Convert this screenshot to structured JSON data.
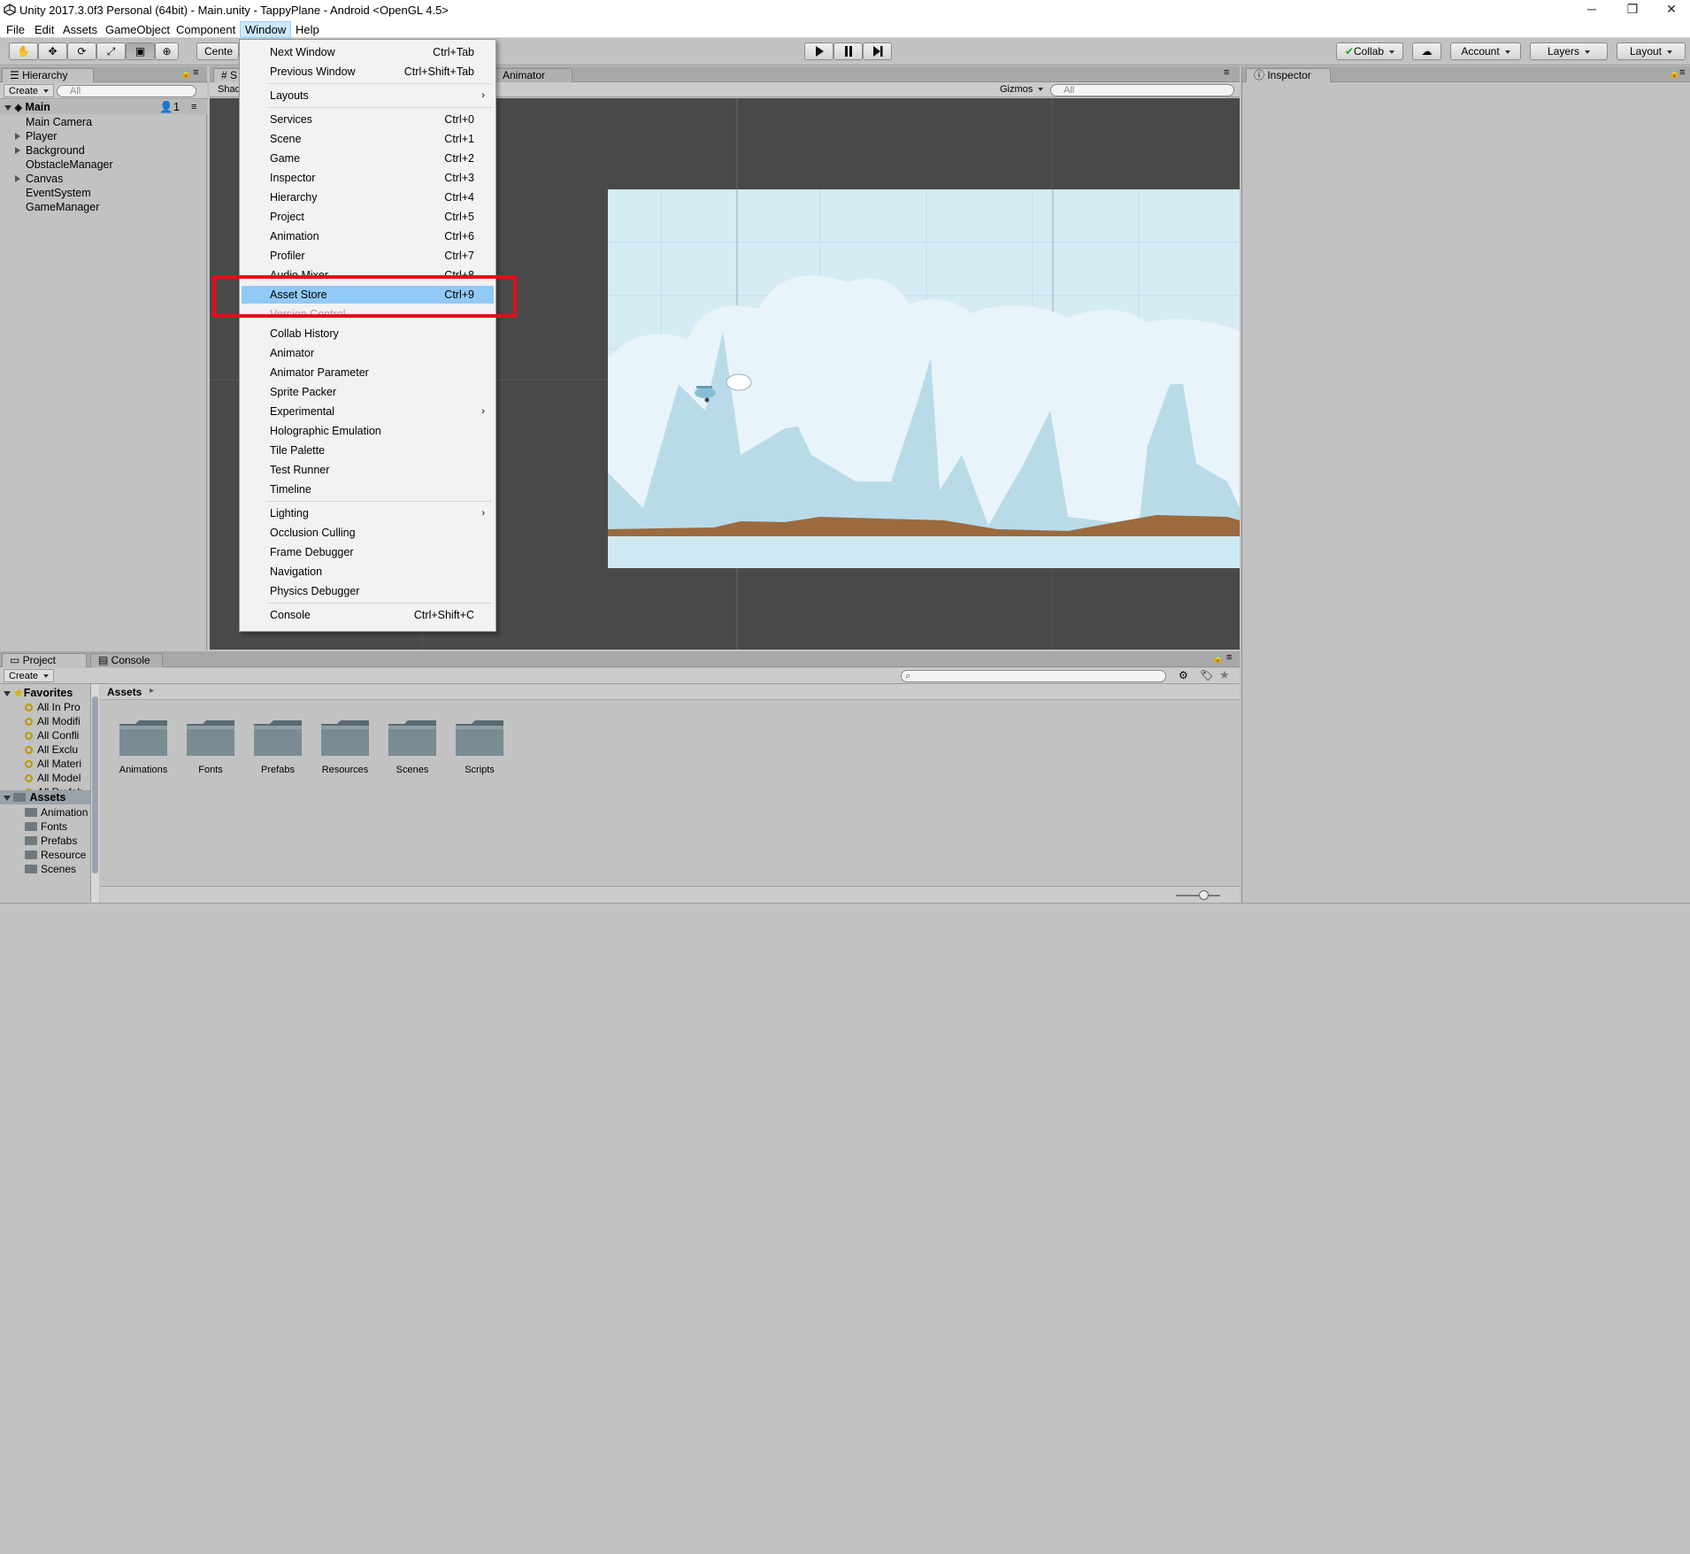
{
  "window": {
    "title": "Unity 2017.3.0f3 Personal (64bit) - Main.unity - TappyPlane - Android <OpenGL 4.5>",
    "controls": {
      "minimize": "─",
      "restore": "❐",
      "close": "✕"
    }
  },
  "menubar": {
    "items": [
      "File",
      "Edit",
      "Assets",
      "GameObject",
      "Component",
      "Window",
      "Help"
    ],
    "active": "Window"
  },
  "toolbar": {
    "pivot_label": "Cente",
    "collab_label": "Collab",
    "account_label": "Account",
    "layers_label": "Layers",
    "layout_label": "Layout"
  },
  "hierarchy": {
    "tab_label": "Hierarchy",
    "create_label": "Create",
    "search_placeholder": "All",
    "scene_name": "Main",
    "user_count": "1",
    "items": [
      {
        "label": "Main Camera",
        "expandable": false
      },
      {
        "label": "Player",
        "expandable": true
      },
      {
        "label": "Background",
        "expandable": true
      },
      {
        "label": "ObstacleManager",
        "expandable": false
      },
      {
        "label": "Canvas",
        "expandable": true
      },
      {
        "label": "EventSystem",
        "expandable": false
      },
      {
        "label": "GameManager",
        "expandable": false
      }
    ]
  },
  "scene_view": {
    "tab_label": "S",
    "animator_tab_label": "Animator",
    "shading_label": "Shad",
    "gizmos_label": "Gizmos",
    "search_placeholder": "All"
  },
  "inspector": {
    "tab_label": "Inspector"
  },
  "window_menu": {
    "items": [
      {
        "label": "Next Window",
        "shortcut": "Ctrl+Tab"
      },
      {
        "label": "Previous Window",
        "shortcut": "Ctrl+Shift+Tab"
      },
      {
        "sep": true
      },
      {
        "label": "Layouts",
        "submenu": true
      },
      {
        "sep": true
      },
      {
        "label": "Services",
        "shortcut": "Ctrl+0"
      },
      {
        "label": "Scene",
        "shortcut": "Ctrl+1"
      },
      {
        "label": "Game",
        "shortcut": "Ctrl+2"
      },
      {
        "label": "Inspector",
        "shortcut": "Ctrl+3"
      },
      {
        "label": "Hierarchy",
        "shortcut": "Ctrl+4"
      },
      {
        "label": "Project",
        "shortcut": "Ctrl+5"
      },
      {
        "label": "Animation",
        "shortcut": "Ctrl+6"
      },
      {
        "label": "Profiler",
        "shortcut": "Ctrl+7"
      },
      {
        "label": "Audio Mixer",
        "shortcut": "Ctrl+8"
      },
      {
        "label": "Asset Store",
        "shortcut": "Ctrl+9",
        "highlighted": true
      },
      {
        "label": "Version Control",
        "disabled": true
      },
      {
        "label": "Collab History"
      },
      {
        "label": "Animator"
      },
      {
        "label": "Animator Parameter"
      },
      {
        "label": "Sprite Packer"
      },
      {
        "label": "Experimental",
        "submenu": true
      },
      {
        "label": "Holographic Emulation"
      },
      {
        "label": "Tile Palette"
      },
      {
        "label": "Test Runner"
      },
      {
        "label": "Timeline"
      },
      {
        "sep": true
      },
      {
        "label": "Lighting",
        "submenu": true
      },
      {
        "label": "Occlusion Culling"
      },
      {
        "label": "Frame Debugger"
      },
      {
        "label": "Navigation"
      },
      {
        "label": "Physics Debugger"
      },
      {
        "sep": true
      },
      {
        "label": "Console",
        "shortcut": "Ctrl+Shift+C"
      }
    ]
  },
  "project": {
    "tab_label": "Project",
    "console_tab_label": "Console",
    "create_label": "Create",
    "favorites_label": "Favorites",
    "favorites": [
      "All In Pro",
      "All Modifi",
      "All Confli",
      "All Exclu",
      "All Materi",
      "All Model",
      "All Prefab"
    ],
    "assets_label": "Assets",
    "asset_tree": [
      "Animation",
      "Fonts",
      "Prefabs",
      "Resource",
      "Scenes"
    ],
    "breadcrumb": "Assets",
    "folders": [
      "Animations",
      "Fonts",
      "Prefabs",
      "Resources",
      "Scenes",
      "Scripts"
    ]
  },
  "colors": {
    "highlight": "#91c9f7",
    "annotation_box": "#e0101a",
    "scene_bg": "#494949",
    "sky": "#cfe9f3",
    "ground": "#9b6a3e"
  }
}
